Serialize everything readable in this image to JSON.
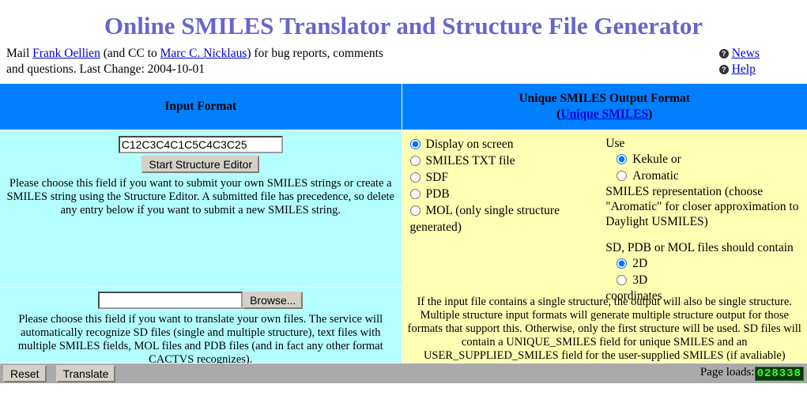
{
  "page": {
    "title": "Online SMILES Translator and Structure File Generator"
  },
  "contact": {
    "prefix": "Mail ",
    "mail_link": "Frank Oellien",
    "middle": " (and CC to ",
    "cc_link": "Marc C. Nicklaus",
    "suffix": ") for bug reports, comments and questions. Last Change: 2004-10-01"
  },
  "helplinks": {
    "news": "News",
    "help": "Help",
    "icon": "question-mark-icon"
  },
  "headers": {
    "input_format": "Input Format",
    "output_format": "Unique SMILES Output Format",
    "output_format_link_open": "(",
    "output_format_link": "Unique SMILES",
    "output_format_link_close": ")"
  },
  "input_panel": {
    "smiles_value": "C12C3C4C1C5C4C3C25",
    "smiles_placeholder": "",
    "structure_editor_button": "Start Structure Editor",
    "smiles_help": "Please choose this field if you want to submit your own SMILES strings or create a SMILES string using the Structure Editor. A submitted file has precedence, so delete any entry below if you want to submit a new SMILES string.",
    "file_value": "",
    "file_placeholder": "",
    "browse_button": "Browse...",
    "file_help": "Please choose this field if you want to translate your own files. The service will automatically recognize SD files (single and multiple structure), text files with multiple SMILES fields, MOL files and PDB files (and in fact any other format CACTVS recognizes)."
  },
  "output_panel": {
    "format_options": [
      {
        "label": "Display on screen",
        "selected": true
      },
      {
        "label": "SMILES TXT file",
        "selected": false
      },
      {
        "label": "SDF",
        "selected": false
      },
      {
        "label": "PDB",
        "selected": false
      },
      {
        "label": "MOL (only single structure generated)",
        "selected": false
      }
    ],
    "use_label": "Use",
    "representation_options": [
      {
        "label": "Kekule or",
        "selected": true
      },
      {
        "label": "Aromatic",
        "selected": false
      }
    ],
    "representation_note": "SMILES representation (choose \"Aromatic\" for closer approximation to Daylight USMILES)",
    "coords_label": "SD, PDB or MOL files should contain",
    "coord_options": [
      {
        "label": "2D",
        "selected": true
      },
      {
        "label": "3D",
        "selected": false
      }
    ],
    "coords_suffix": "coordinates",
    "note": "If the input file contains a single structure, the output will also be single structure. Multiple structure input formats will generate multiple structure output for those formats that support this. Otherwise, only the first structure will be used. SD files will contain a UNIQUE_SMILES field for unique SMILES and an USER_SUPPLIED_SMILES field for the user-supplied SMILES (if avaliable)"
  },
  "bottom_bar": {
    "reset_button": "Reset",
    "translate_button": "Translate",
    "page_loads_label": "Page loads:",
    "page_loads_count": "028338"
  },
  "colors": {
    "title": "#6666cc",
    "header_bar": "#0080ff",
    "left_panel": "#b3ffff",
    "right_panel": "#ffffb3",
    "bottom_bar": "#aaaaaa",
    "link": "#0000cc",
    "counter_fg": "#33ff33",
    "counter_bg": "#0a3a0a"
  }
}
